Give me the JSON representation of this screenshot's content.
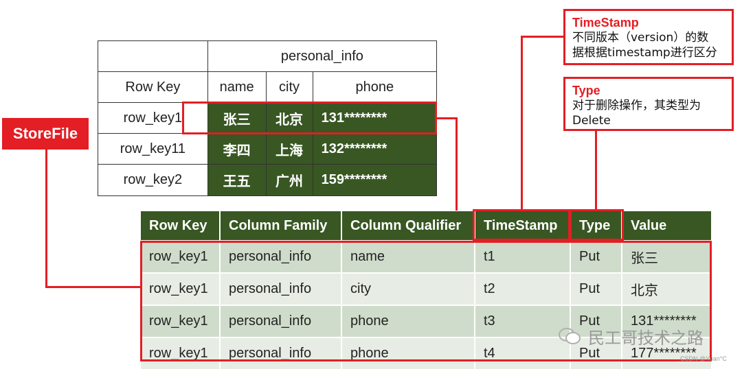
{
  "top_table": {
    "family": "personal_info",
    "row_key_header": "Row Key",
    "columns": [
      "name",
      "city",
      "phone"
    ],
    "rows": [
      {
        "key": "row_key1",
        "name": "张三",
        "city": "北京",
        "phone": "131********"
      },
      {
        "key": "row_key11",
        "name": "李四",
        "city": "上海",
        "phone": "132********"
      },
      {
        "key": "row_key2",
        "name": "王五",
        "city": "广州",
        "phone": "159********"
      }
    ]
  },
  "bottom_table": {
    "headers": [
      "Row Key",
      "Column Family",
      "Column Qualifier",
      "TimeStamp",
      "Type",
      "Value"
    ],
    "rows": [
      [
        "row_key1",
        "personal_info",
        "name",
        "t1",
        "Put",
        "张三"
      ],
      [
        "row_key1",
        "personal_info",
        "city",
        "t2",
        "Put",
        "北京"
      ],
      [
        "row_key1",
        "personal_info",
        "phone",
        "t3",
        "Put",
        "131********"
      ],
      [
        "row_key1",
        "personal_info",
        "phone",
        "t4",
        "Put",
        "177********"
      ]
    ]
  },
  "labels": {
    "storefile": "StoreFile",
    "timestamp_title": "TimeStamp",
    "timestamp_line1": "不同版本（version）的数",
    "timestamp_line2": "据根据timestamp进行区分",
    "type_title": "Type",
    "type_line1": "对于删除操作，其类型为",
    "type_line2": "Delete"
  },
  "watermark": {
    "main": "民工哥技术之路",
    "small": "CSDN @Yuan°C"
  },
  "colors": {
    "dark_green": "#385723",
    "red": "#e31e24",
    "row_light": "#cfdccb",
    "row_lighter": "#e7ede4"
  }
}
